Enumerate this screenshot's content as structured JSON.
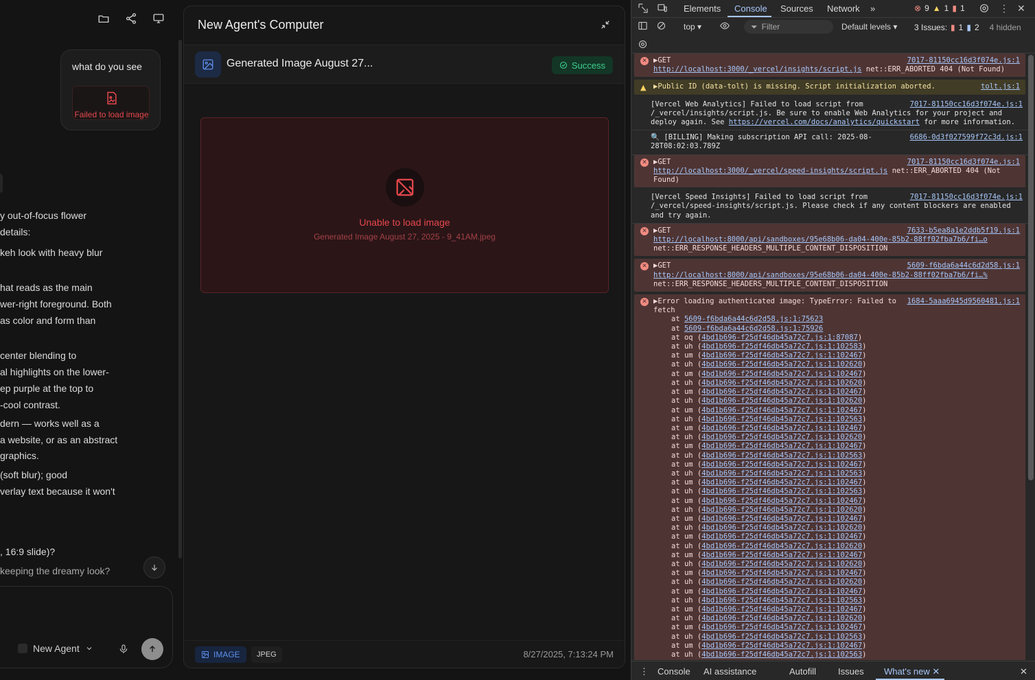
{
  "chat": {
    "user_message": "what do you see",
    "failed_image_label": "Failed to load image",
    "lines": [
      "y out-of-focus flower",
      "details:",
      "keh look with heavy blur",
      "hat reads as the main",
      "wer-right foreground. Both",
      "as color and form than",
      "center blending to",
      "al highlights on the lower-",
      "ep purple at the top to",
      "-cool contrast.",
      "dern — works well as a",
      "a website, or as an abstract",
      "graphics.",
      "(soft blur); good",
      "verlay text because it won't",
      ", 16:9 slide)?",
      "keeping the dreamy look?"
    ],
    "agent_label": "New Agent"
  },
  "computer": {
    "title": "New Agent's Computer",
    "file_name": "Generated Image August 27...",
    "status": "Success",
    "error_title": "Unable to load image",
    "error_file": "Generated Image August 27, 2025 - 9_41AM.jpeg",
    "type_badge": "IMAGE",
    "format_badge": "JPEG",
    "timestamp": "8/27/2025, 7:13:24 PM"
  },
  "devtools": {
    "tabs": [
      "Elements",
      "Console",
      "Sources",
      "Network"
    ],
    "active_tab": "Console",
    "errors_count": "9",
    "warnings_count": "1",
    "issues_count": "1",
    "context": "top",
    "filter_placeholder": "Filter",
    "levels": "Default levels",
    "issues_label": "3 Issues:",
    "issues_err": "1",
    "issues_info": "2",
    "hidden": "4 hidden",
    "bottom_tabs": [
      "Console",
      "AI assistance",
      "Autofill",
      "Issues",
      "What's new"
    ],
    "entries": [
      {
        "type": "error",
        "text": "▶GET",
        "src": "7017-81150cc16d3f074e.js:1",
        "detail_link": "http://localhost:3000/_vercel/insights/script.js",
        "detail": " net::ERR_ABORTED 404 (Not Found)"
      },
      {
        "type": "warn",
        "text": "▶Public ID (data-tolt) is missing. Script initialization aborted.",
        "src": "tolt.js:1"
      },
      {
        "type": "log",
        "text": "[Vercel Web Analytics] Failed to load script from /_vercel/insights/script.js. Be sure to enable Web Analytics for your project and deploy again. See ",
        "link": "https://vercel.com/docs/analytics/quickstart",
        "tail": " for more information.",
        "src": "7017-81150cc16d3f074e.js:1"
      },
      {
        "type": "log",
        "text": "🔍 [BILLING] Making subscription API call: 2025-08-28T08:02:03.789Z",
        "src": "6686-0d3f027599f72c3d.js:1"
      },
      {
        "type": "error",
        "text": "▶GET",
        "src": "7017-81150cc16d3f074e.js:1",
        "detail_link": "http://localhost:3000/_vercel/speed-insights/script.js",
        "detail": " net::ERR_ABORTED 404 (Not Found)"
      },
      {
        "type": "log",
        "text": "[Vercel Speed Insights] Failed to load script from /_vercel/speed-insights/script.js. Please check if any content blockers are enabled and try again.",
        "src": "7017-81150cc16d3f074e.js:1"
      },
      {
        "type": "error",
        "text": "▶GET",
        "src": "7633-b5ea8a1e2ddb5f19.js:1",
        "detail_link": "http://localhost:8000/api/sandboxes/95e68b06-da04-400e-85b2-88ff02fba7b6/fi…o",
        "detail": " net::ERR_RESPONSE_HEADERS_MULTIPLE_CONTENT_DISPOSITION"
      },
      {
        "type": "error",
        "text": "▶GET",
        "src": "5609-f6bda6a44c6d2d58.js:1",
        "detail_link": "http://localhost:8000/api/sandboxes/95e68b06-da04-400e-85b2-88ff02fba7b6/fi…%",
        "detail": " net::ERR_RESPONSE_HEADERS_MULTIPLE_CONTENT_DISPOSITION"
      }
    ],
    "stack_error": {
      "text": "▶Error loading authenticated image: TypeError: Failed to fetch",
      "src": "1684-5aaa6945d9560481.js:1",
      "frames": [
        [
          "",
          "5609-f6bda6a44c6d2d58.js:1:75623"
        ],
        [
          "",
          "5609-f6bda6a44c6d2d58.js:1:75926"
        ],
        [
          "oq",
          "4bd1b696-f25df46db45a72c7.js:1:87087"
        ],
        [
          "uh",
          "4bd1b696-f25df46db45a72c7.js:1:102583"
        ],
        [
          "um",
          "4bd1b696-f25df46db45a72c7.js:1:102467"
        ],
        [
          "uh",
          "4bd1b696-f25df46db45a72c7.js:1:102620"
        ],
        [
          "um",
          "4bd1b696-f25df46db45a72c7.js:1:102467"
        ],
        [
          "uh",
          "4bd1b696-f25df46db45a72c7.js:1:102620"
        ],
        [
          "um",
          "4bd1b696-f25df46db45a72c7.js:1:102467"
        ],
        [
          "uh",
          "4bd1b696-f25df46db45a72c7.js:1:102620"
        ],
        [
          "um",
          "4bd1b696-f25df46db45a72c7.js:1:102467"
        ],
        [
          "uh",
          "4bd1b696-f25df46db45a72c7.js:1:102563"
        ],
        [
          "um",
          "4bd1b696-f25df46db45a72c7.js:1:102467"
        ],
        [
          "uh",
          "4bd1b696-f25df46db45a72c7.js:1:102620"
        ],
        [
          "um",
          "4bd1b696-f25df46db45a72c7.js:1:102467"
        ],
        [
          "uh",
          "4bd1b696-f25df46db45a72c7.js:1:102563"
        ],
        [
          "um",
          "4bd1b696-f25df46db45a72c7.js:1:102467"
        ],
        [
          "uh",
          "4bd1b696-f25df46db45a72c7.js:1:102563"
        ],
        [
          "um",
          "4bd1b696-f25df46db45a72c7.js:1:102467"
        ],
        [
          "uh",
          "4bd1b696-f25df46db45a72c7.js:1:102563"
        ],
        [
          "um",
          "4bd1b696-f25df46db45a72c7.js:1:102467"
        ],
        [
          "uh",
          "4bd1b696-f25df46db45a72c7.js:1:102620"
        ],
        [
          "um",
          "4bd1b696-f25df46db45a72c7.js:1:102467"
        ],
        [
          "uh",
          "4bd1b696-f25df46db45a72c7.js:1:102620"
        ],
        [
          "um",
          "4bd1b696-f25df46db45a72c7.js:1:102467"
        ],
        [
          "uh",
          "4bd1b696-f25df46db45a72c7.js:1:102620"
        ],
        [
          "um",
          "4bd1b696-f25df46db45a72c7.js:1:102467"
        ],
        [
          "uh",
          "4bd1b696-f25df46db45a72c7.js:1:102620"
        ],
        [
          "um",
          "4bd1b696-f25df46db45a72c7.js:1:102467"
        ],
        [
          "uh",
          "4bd1b696-f25df46db45a72c7.js:1:102620"
        ],
        [
          "um",
          "4bd1b696-f25df46db45a72c7.js:1:102467"
        ],
        [
          "uh",
          "4bd1b696-f25df46db45a72c7.js:1:102563"
        ],
        [
          "um",
          "4bd1b696-f25df46db45a72c7.js:1:102467"
        ],
        [
          "uh",
          "4bd1b696-f25df46db45a72c7.js:1:102620"
        ],
        [
          "um",
          "4bd1b696-f25df46db45a72c7.js:1:102467"
        ],
        [
          "uh",
          "4bd1b696-f25df46db45a72c7.js:1:102563"
        ],
        [
          "um",
          "4bd1b696-f25df46db45a72c7.js:1:102467"
        ],
        [
          "uh",
          "4bd1b696-f25df46db45a72c7.js:1:102563"
        ],
        [
          "um",
          "4bd1b696-f25df46db45a72c7.js:1:102467"
        ],
        [
          "uh",
          "4bd1b696-f25df46db45a72c7.js:1:102563"
        ]
      ]
    }
  }
}
